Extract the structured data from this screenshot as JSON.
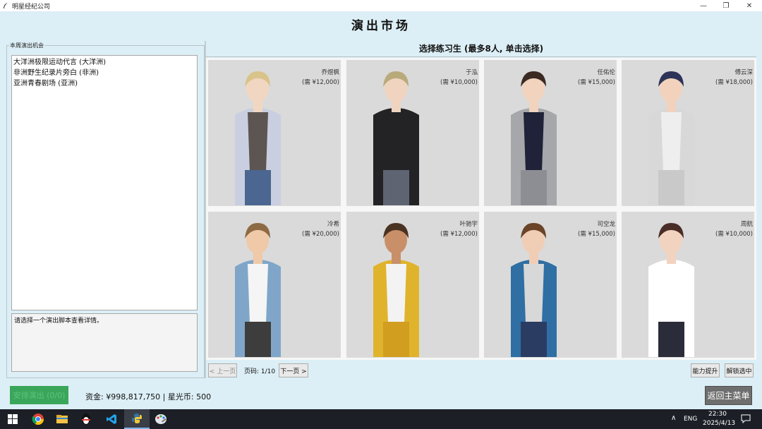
{
  "window": {
    "title": "明星经纪公司",
    "min_glyph": "—",
    "max_glyph": "❐",
    "close_glyph": "✕"
  },
  "page": {
    "heading": "演出市场"
  },
  "opportunities": {
    "legend": "本周演出机会",
    "items": [
      "大洋洲极限运动代言 (大洋洲)",
      "非洲野生纪录片旁白 (非洲)",
      "亚洲青春剧场 (亚洲)"
    ],
    "detail_text": "请选择一个演出脚本查看详情。"
  },
  "trainees": {
    "title": "选择练习生 (最多8人, 单击选择)",
    "cards": [
      {
        "name": "乔煜枫",
        "cost": "(需 ¥12,000)",
        "hair": "#d8c48a",
        "skin": "#f1d7c2",
        "top": "#5d5552",
        "jacket": "#c9cfe0",
        "pants": "#4b6690"
      },
      {
        "name": "于泓",
        "cost": "(需 ¥10,000)",
        "hair": "#b9aa7a",
        "skin": "#f0d4c0",
        "top": "#232325",
        "jacket": "#232325",
        "pants": "#5f6473"
      },
      {
        "name": "任佑伦",
        "cost": "(需 ¥15,000)",
        "hair": "#3b2a22",
        "skin": "#f1d3be",
        "top": "#1f2238",
        "jacket": "#a6a7ab",
        "pants": "#8d8e93"
      },
      {
        "name": "傅云深",
        "cost": "(需 ¥18,000)",
        "hair": "#2d3258",
        "skin": "#f2d2bc",
        "top": "#eeeeee",
        "jacket": "#d8d8d8",
        "pants": "#c9c9c9"
      },
      {
        "name": "冷希",
        "cost": "(需 ¥20,000)",
        "hair": "#8d6a44",
        "skin": "#efc9a8",
        "top": "#f5f5f5",
        "jacket": "#7fa6c9",
        "pants": "#3d3d3d"
      },
      {
        "name": "叶驰宇",
        "cost": "(需 ¥12,000)",
        "hair": "#4a3222",
        "skin": "#c98f68",
        "top": "#f3f3f3",
        "jacket": "#e0b32c",
        "pants": "#d19e20"
      },
      {
        "name": "司空龙",
        "cost": "(需 ¥15,000)",
        "hair": "#6a4328",
        "skin": "#f0cdb5",
        "top": "#d8d8d8",
        "jacket": "#2f6fa3",
        "pants": "#2b3c63"
      },
      {
        "name": "周航",
        "cost": "(需 ¥10,000)",
        "hair": "#4a2d27",
        "skin": "#f2d3bf",
        "top": "#ffffff",
        "jacket": "#ffffff",
        "pants": "#2a2c3a"
      }
    ]
  },
  "pager": {
    "prev_label": "< 上一页",
    "page_label": "页码: 1/10",
    "next_label": "下一页 >",
    "boost_label": "能力提升",
    "unlock_label": "解锁选中"
  },
  "footer": {
    "perform_label": "安排演出 (0/0)",
    "funds_text": "资金: ¥998,817,750 | 星光币: 500",
    "back_label": "返回主菜单"
  },
  "taskbar": {
    "tray_up": "∧",
    "lang": "ENG",
    "time": "22:30",
    "date": "2025/4/13"
  }
}
